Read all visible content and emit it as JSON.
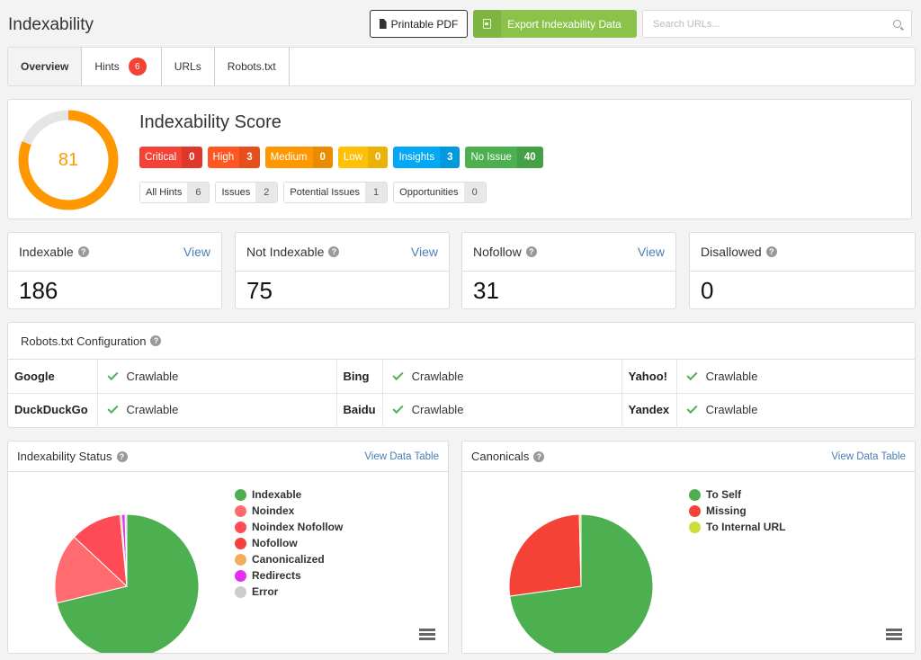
{
  "header": {
    "title": "Indexability",
    "pdf_button": "Printable PDF",
    "export_button": "Export Indexability Data",
    "search_placeholder": "Search URLs..."
  },
  "tabs": [
    {
      "label": "Overview",
      "active": true
    },
    {
      "label": "Hints",
      "badge": "6"
    },
    {
      "label": "URLs"
    },
    {
      "label": "Robots.txt"
    }
  ],
  "score": {
    "title": "Indexability Score",
    "value": "81",
    "percent": 81,
    "color": "#ff9800",
    "track_color": "#e5e5e5",
    "severity": [
      {
        "label": "Critical",
        "count": "0",
        "color": "#f44336",
        "dark": "#e0372d"
      },
      {
        "label": "High",
        "count": "3",
        "color": "#ff5722",
        "dark": "#e84e1b"
      },
      {
        "label": "Medium",
        "count": "0",
        "color": "#ff9800",
        "dark": "#ea8c00"
      },
      {
        "label": "Low",
        "count": "0",
        "color": "#ffc107",
        "dark": "#ebb105"
      },
      {
        "label": "Insights",
        "count": "3",
        "color": "#03a9f4",
        "dark": "#0399de"
      },
      {
        "label": "No Issue",
        "count": "40",
        "color": "#4caf50",
        "dark": "#43a047"
      }
    ],
    "hint_types": [
      {
        "label": "All Hints",
        "count": "6"
      },
      {
        "label": "Issues",
        "count": "2"
      },
      {
        "label": "Potential Issues",
        "count": "1"
      },
      {
        "label": "Opportunities",
        "count": "0"
      }
    ]
  },
  "stats": [
    {
      "label": "Indexable",
      "value": "186",
      "link": "View"
    },
    {
      "label": "Not Indexable",
      "value": "75",
      "link": "View"
    },
    {
      "label": "Nofollow",
      "value": "31",
      "link": "View"
    },
    {
      "label": "Disallowed",
      "value": "0",
      "link": null
    }
  ],
  "robots": {
    "title": "Robots.txt Configuration",
    "rows": [
      [
        {
          "engine": "Google",
          "status": "Crawlable"
        },
        {
          "engine": "Bing",
          "status": "Crawlable"
        },
        {
          "engine": "Yahoo!",
          "status": "Crawlable"
        }
      ],
      [
        {
          "engine": "DuckDuckGo",
          "status": "Crawlable"
        },
        {
          "engine": "Baidu",
          "status": "Crawlable"
        },
        {
          "engine": "Yandex",
          "status": "Crawlable"
        }
      ]
    ]
  },
  "chart_data": [
    {
      "type": "pie",
      "title": "Indexability Status",
      "link": "View Data Table",
      "legend_position": "right",
      "series": [
        {
          "name": "Indexable",
          "value": 186,
          "color": "#4caf50"
        },
        {
          "name": "Noindex",
          "value": 41,
          "color": "#ff6b6e"
        },
        {
          "name": "Noindex Nofollow",
          "value": 30,
          "color": "#ff4b55"
        },
        {
          "name": "Nofollow",
          "value": 0,
          "color": "#f5413c"
        },
        {
          "name": "Canonicalized",
          "value": 1,
          "color": "#f0ad5e"
        },
        {
          "name": "Redirects",
          "value": 2,
          "color": "#e52ef5"
        },
        {
          "name": "Error",
          "value": 1,
          "color": "#cccccc"
        }
      ]
    },
    {
      "type": "pie",
      "title": "Canonicals",
      "link": "View Data Table",
      "legend_position": "right",
      "series": [
        {
          "name": "To Self",
          "value": 190,
          "color": "#4caf50"
        },
        {
          "name": "Missing",
          "value": 70,
          "color": "#f44336"
        },
        {
          "name": "To Internal URL",
          "value": 1,
          "color": "#cddc39"
        }
      ]
    }
  ]
}
